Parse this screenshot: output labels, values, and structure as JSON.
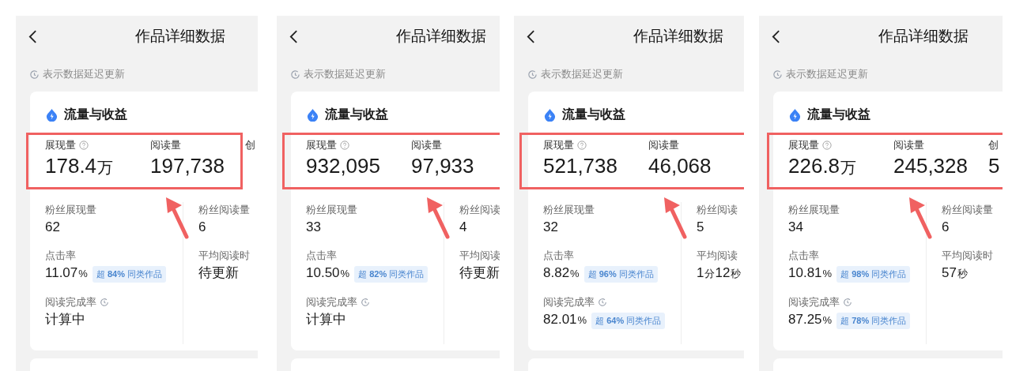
{
  "panels": [
    {
      "title": "作品详细数据",
      "notice": "表示数据延迟更新",
      "section": "流量与收益",
      "highlighted": true,
      "main": [
        {
          "label": "展现量",
          "help": true,
          "value": "178.4",
          "unit": "万"
        },
        {
          "label": "阅读量",
          "help": false,
          "value": "197,738"
        },
        {
          "label": "创",
          "help": false
        }
      ],
      "columns": [
        [
          {
            "label": "粉丝展现量",
            "value": "62"
          },
          {
            "label": "点击率",
            "value": "11.07",
            "unit": "%",
            "badge": "超 **84%** 同类作品"
          },
          {
            "label": "阅读完成率",
            "clock": true,
            "value": "计算中"
          }
        ],
        [
          {
            "label": "粉丝阅读量",
            "value": "6"
          },
          {
            "label": "平均阅读时",
            "value": "待更新"
          }
        ]
      ]
    },
    {
      "title": "作品详细数据",
      "notice": "表示数据延迟更新",
      "section": "流量与收益",
      "highlighted": true,
      "main": [
        {
          "label": "展现量",
          "help": true,
          "value": "932,095"
        },
        {
          "label": "阅读量",
          "help": false,
          "value": "97,933"
        }
      ],
      "columns": [
        [
          {
            "label": "粉丝展现量",
            "value": "33"
          },
          {
            "label": "点击率",
            "value": "10.50",
            "unit": "%",
            "badge": "超 **82%** 同类作品"
          },
          {
            "label": "阅读完成率",
            "clock": true,
            "value": "计算中"
          }
        ],
        [
          {
            "label": "粉丝阅读",
            "value": "4"
          },
          {
            "label": "平均阅读",
            "value": "待更新"
          }
        ]
      ]
    },
    {
      "title": "作品详细数据",
      "notice": "表示数据延迟更新",
      "section": "流量与收益",
      "highlighted": true,
      "main": [
        {
          "label": "展现量",
          "help": true,
          "value": "521,738"
        },
        {
          "label": "阅读量",
          "help": false,
          "value": "46,068"
        }
      ],
      "columns": [
        [
          {
            "label": "粉丝展现量",
            "value": "32"
          },
          {
            "label": "点击率",
            "value": "8.82",
            "unit": "%",
            "badge": "超 **96%** 同类作品"
          },
          {
            "label": "阅读完成率",
            "clock": true,
            "value": "82.01",
            "unit": "%",
            "badge": "超 **64%** 同类作品"
          }
        ],
        [
          {
            "label": "粉丝阅读",
            "value": "5"
          },
          {
            "label": "平均阅读",
            "value": "1",
            "unit": "分",
            "value2": "12",
            "unit2": "秒"
          }
        ]
      ]
    },
    {
      "title": "作品详细数据",
      "notice": "表示数据延迟更新",
      "section": "流量与收益",
      "highlighted": true,
      "main": [
        {
          "label": "展现量",
          "help": true,
          "value": "226.8",
          "unit": "万"
        },
        {
          "label": "阅读量",
          "help": false,
          "value": "245,328"
        },
        {
          "label": "创",
          "help": false,
          "value": "5"
        }
      ],
      "columns": [
        [
          {
            "label": "粉丝展现量",
            "value": "34"
          },
          {
            "label": "点击率",
            "value": "10.81",
            "unit": "%",
            "badge": "超 **98%** 同类作品"
          },
          {
            "label": "阅读完成率",
            "clock": true,
            "value": "87.25",
            "unit": "%",
            "badge": "超 **78%** 同类作品"
          }
        ],
        [
          {
            "label": "粉丝阅读量",
            "value": "6"
          },
          {
            "label": "平均阅读时",
            "value": "57",
            "unit": "秒"
          }
        ]
      ]
    }
  ]
}
